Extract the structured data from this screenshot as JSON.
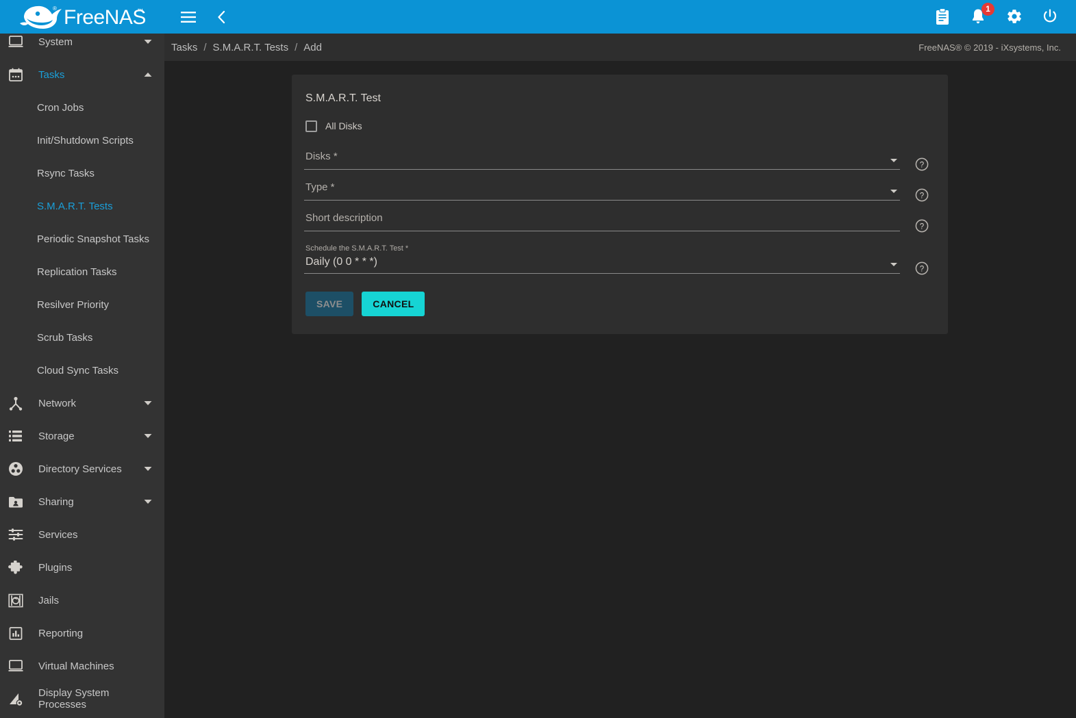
{
  "brand": {
    "name": "FreeNAS",
    "logo_icon": "freenas-shark-logo"
  },
  "topbar": {
    "menu_icon": "hamburger-menu-icon",
    "collapse_icon": "chevron-left-icon",
    "clipboard_icon": "clipboard-icon",
    "notifications_icon": "bell-icon",
    "notifications_count": "1",
    "settings_icon": "gear-icon",
    "power_icon": "power-icon"
  },
  "breadcrumb": {
    "items": [
      "Tasks",
      "S.M.A.R.T. Tests",
      "Add"
    ],
    "separator": "/"
  },
  "footer": {
    "copyright": "FreeNAS® © 2019 - iXsystems, Inc."
  },
  "sidebar": {
    "items": [
      {
        "label": "System",
        "icon": "monitor-icon",
        "caret": "chevron-down-icon",
        "active": false
      },
      {
        "label": "Tasks",
        "icon": "calendar-icon",
        "caret": "chevron-up-icon",
        "active": true
      },
      {
        "label": "Network",
        "icon": "network-icon",
        "caret": "chevron-down-icon",
        "active": false
      },
      {
        "label": "Storage",
        "icon": "storage-icon",
        "caret": "chevron-down-icon",
        "active": false
      },
      {
        "label": "Directory Services",
        "icon": "directory-services-icon",
        "caret": "chevron-down-icon",
        "active": false
      },
      {
        "label": "Sharing",
        "icon": "shared-folder-icon",
        "caret": "chevron-down-icon",
        "active": false
      },
      {
        "label": "Services",
        "icon": "sliders-icon",
        "caret": "",
        "active": false
      },
      {
        "label": "Plugins",
        "icon": "puzzle-piece-icon",
        "caret": "",
        "active": false
      },
      {
        "label": "Jails",
        "icon": "jail-icon",
        "caret": "",
        "active": false
      },
      {
        "label": "Reporting",
        "icon": "bar-chart-icon",
        "caret": "",
        "active": false
      },
      {
        "label": "Virtual Machines",
        "icon": "laptop-icon",
        "caret": "",
        "active": false
      },
      {
        "label": "Display System Processes",
        "icon": "processes-icon",
        "caret": "",
        "active": false
      }
    ],
    "tasks_subitems": [
      {
        "label": "Cron Jobs",
        "active": false
      },
      {
        "label": "Init/Shutdown Scripts",
        "active": false
      },
      {
        "label": "Rsync Tasks",
        "active": false
      },
      {
        "label": "S.M.A.R.T. Tests",
        "active": true
      },
      {
        "label": "Periodic Snapshot Tasks",
        "active": false
      },
      {
        "label": "Replication Tasks",
        "active": false
      },
      {
        "label": "Resilver Priority",
        "active": false
      },
      {
        "label": "Scrub Tasks",
        "active": false
      },
      {
        "label": "Cloud Sync Tasks",
        "active": false
      }
    ]
  },
  "form": {
    "title": "S.M.A.R.T. Test",
    "all_disks": {
      "label": "All Disks",
      "checked": false
    },
    "disks": {
      "label": "Disks *",
      "value": "",
      "help_icon": "help-circle-icon",
      "caret": "dropdown-caret-icon"
    },
    "type": {
      "label": "Type *",
      "value": "",
      "help_icon": "help-circle-icon",
      "caret": "dropdown-caret-icon"
    },
    "short_description": {
      "label": "Short description",
      "value": "",
      "help_icon": "help-circle-icon"
    },
    "schedule": {
      "label": "Schedule the S.M.A.R.T. Test *",
      "value": "Daily (0 0 * * *)",
      "help_icon": "help-circle-icon",
      "caret": "dropdown-caret-icon"
    },
    "save_label": "SAVE",
    "cancel_label": "CANCEL"
  },
  "colors": {
    "brand_blue": "#0b93d5",
    "accent_cyan": "#16d4d4",
    "active_link": "#1a9fd9",
    "badge_red": "#e53935",
    "sidebar_bg": "#333333",
    "card_bg": "#2e2e2e",
    "page_bg": "#212121"
  }
}
